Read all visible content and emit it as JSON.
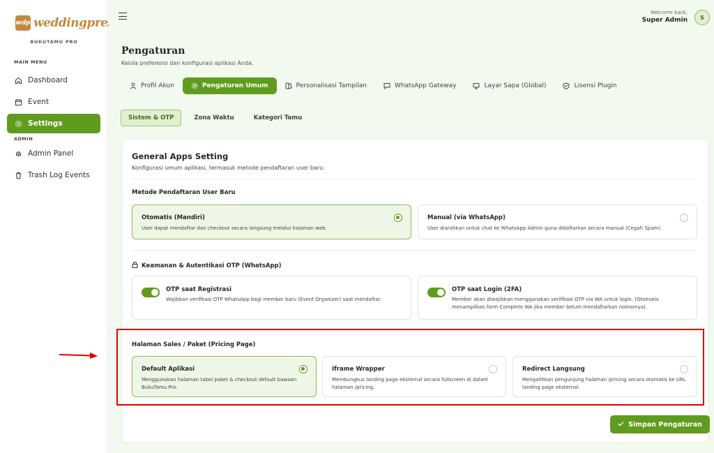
{
  "brand": {
    "logo_mark": "wdp",
    "logo_text": "weddingpress",
    "logo_sub": "BUKUTAMU PRO"
  },
  "sidebar": {
    "main_menu_label": "MAIN MENU",
    "admin_label": "ADMIN",
    "items": [
      {
        "label": "Dashboard",
        "icon": "home-icon"
      },
      {
        "label": "Event",
        "icon": "calendar-icon"
      },
      {
        "label": "Settings",
        "icon": "settings-icon",
        "active": true
      },
      {
        "label": "Admin Panel",
        "icon": "fingerprint-icon"
      },
      {
        "label": "Trash Log Events",
        "icon": "trash-icon"
      }
    ]
  },
  "header": {
    "welcome": "Welcome back,",
    "user_name": "Super Admin",
    "avatar_initial": "S"
  },
  "page": {
    "title": "Pengaturan",
    "subtitle": "Kelola preferensi dan konfigurasi aplikasi Anda."
  },
  "tabs": [
    {
      "label": "Profil Akun",
      "icon": "user-icon"
    },
    {
      "label": "Pengaturan Umum",
      "icon": "gear-icon",
      "active": true
    },
    {
      "label": "Personalisasi Tampilan",
      "icon": "palette-icon"
    },
    {
      "label": "WhatsApp Gateway",
      "icon": "message-icon"
    },
    {
      "label": "Layar Sapa (Global)",
      "icon": "monitor-icon"
    },
    {
      "label": "Lisensi Plugin",
      "icon": "shield-icon"
    }
  ],
  "subtabs": [
    {
      "label": "Sistem & OTP",
      "active": true
    },
    {
      "label": "Zona Waktu"
    },
    {
      "label": "Kategori Tamu"
    }
  ],
  "card": {
    "title": "General Apps Setting",
    "subtitle": "Konfigurasi umum aplikasi, termasuk metode pendaftaran user baru.",
    "registration": {
      "label": "Metode Pendaftaran User Baru",
      "options": [
        {
          "title": "Otomatis (Mandiri)",
          "desc": "User dapat mendaftar dan checkout secara langsung melalui halaman web.",
          "selected": true
        },
        {
          "title": "Manual (via WhatsApp)",
          "desc": "User diarahkan untuk chat ke WhatsApp Admin guna didaftarkan secara manual (Cegah Spam).",
          "selected": false
        }
      ]
    },
    "security": {
      "label": "Keamanan & Autentikasi OTP (WhatsApp)",
      "toggles": [
        {
          "title": "OTP saat Registrasi",
          "desc": "Wajibkan verifikasi OTP WhatsApp bagi member baru (Event Organizer) saat mendaftar.",
          "on": true
        },
        {
          "title": "OTP saat Login (2FA)",
          "desc": "Member akan diwajibkan menggunakan verifikasi OTP via WA untuk login. (Otomatis menampilkan form Complete WA jika member belum mendaftarkan nomornya).",
          "on": true
        }
      ]
    },
    "pricing": {
      "label": "Halaman Sales / Paket (Pricing Page)",
      "options": [
        {
          "title": "Default Aplikasi",
          "desc": "Menggunakan halaman tabel paket & checkout default bawaan BukuTamu Pro.",
          "selected": true
        },
        {
          "title": "Iframe Wrapper",
          "desc": "Membungkus landing page eksternal secara fullscreen di dalam halaman /pricing.",
          "selected": false
        },
        {
          "title": "Redirect Langsung",
          "desc": "Mengalihkan pengunjung halaman /pricing secara otomatis ke URL landing page eksternal.",
          "selected": false
        }
      ]
    },
    "save_label": "Simpan Pengaturan"
  },
  "colors": {
    "accent": "#5f9c1e",
    "highlight": "#e00000",
    "brand": "#c08a3e"
  }
}
